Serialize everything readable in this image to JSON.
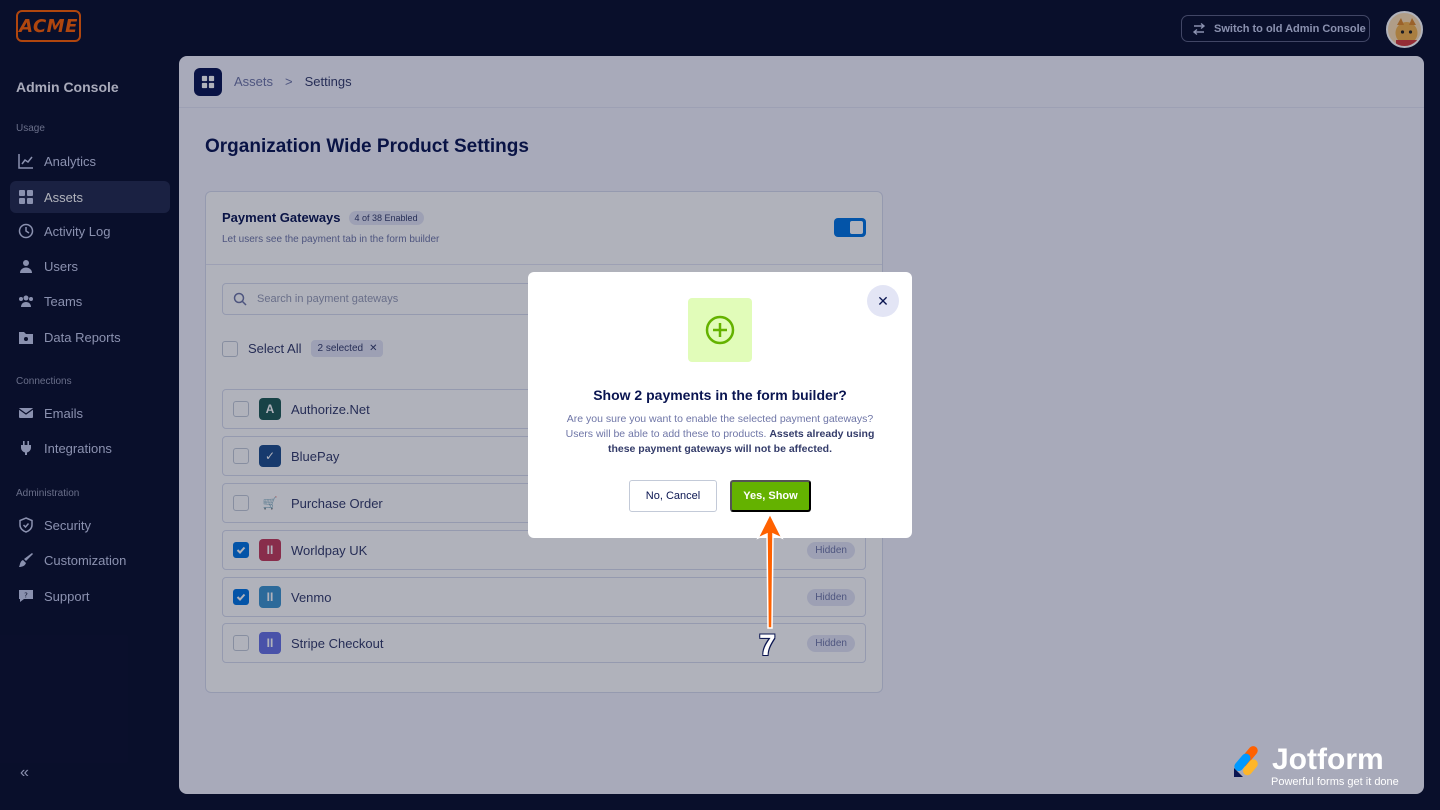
{
  "topbar": {
    "logo_text": "ACME",
    "switch_label": "Switch to old Admin Console"
  },
  "sidebar": {
    "title": "Admin Console",
    "sections": {
      "usage": "Usage",
      "connections": "Connections",
      "administration": "Administration"
    },
    "items": [
      {
        "label": "Analytics",
        "icon": "analytics-icon"
      },
      {
        "label": "Assets",
        "icon": "assets-icon",
        "active": true
      },
      {
        "label": "Activity Log",
        "icon": "activity-log-icon"
      },
      {
        "label": "Users",
        "icon": "users-icon"
      },
      {
        "label": "Teams",
        "icon": "teams-icon"
      },
      {
        "label": "Data Reports",
        "icon": "data-reports-icon"
      },
      {
        "label": "Emails",
        "icon": "email-icon"
      },
      {
        "label": "Integrations",
        "icon": "plug-icon"
      },
      {
        "label": "Security",
        "icon": "shield-icon"
      },
      {
        "label": "Customization",
        "icon": "brush-icon"
      },
      {
        "label": "Support",
        "icon": "support-icon"
      }
    ],
    "collapse_label": "«"
  },
  "breadcrumb": {
    "items": [
      "Assets",
      "Settings"
    ],
    "separator": ">"
  },
  "page": {
    "title": "Organization Wide Product Settings"
  },
  "card": {
    "title": "Payment Gateways",
    "badge": "4 of 38 Enabled",
    "subtitle": "Let users see the payment tab in the form builder",
    "search_placeholder": "Search in payment gateways",
    "select_all_label": "Select All",
    "selected_chip": "2 selected",
    "gateways": [
      {
        "name": "Authorize.Net",
        "checked": false,
        "status": "",
        "icon_color": "#1f5c55",
        "icon_glyph": "A"
      },
      {
        "name": "BluePay",
        "checked": false,
        "status": "",
        "icon_color": "#1e4f8c",
        "icon_glyph": "✓"
      },
      {
        "name": "Purchase Order",
        "checked": false,
        "status": "",
        "icon_color": "#ffffff",
        "icon_glyph": "🛒"
      },
      {
        "name": "Worldpay UK",
        "checked": true,
        "status": "Hidden",
        "icon_color": "#c53b5b",
        "icon_glyph": "II"
      },
      {
        "name": "Venmo",
        "checked": true,
        "status": "Hidden",
        "icon_color": "#3d95ce",
        "icon_glyph": "II"
      },
      {
        "name": "Stripe Checkout",
        "checked": false,
        "status": "Hidden",
        "icon_color": "#6772e5",
        "icon_glyph": "II"
      }
    ]
  },
  "modal": {
    "title": "Show 2 payments in the form builder?",
    "body": "Are you sure you want to enable the selected payment gateways? Users will be able to add these to products.",
    "body_bold": "Assets already using these payment gateways will not be affected.",
    "cancel_label": "No, Cancel",
    "confirm_label": "Yes, Show",
    "close_glyph": "✕"
  },
  "annotation": {
    "step": "7",
    "color": "#ff6100"
  },
  "watermark": {
    "name": "Jotform",
    "tagline": "Powerful forms get it done"
  }
}
